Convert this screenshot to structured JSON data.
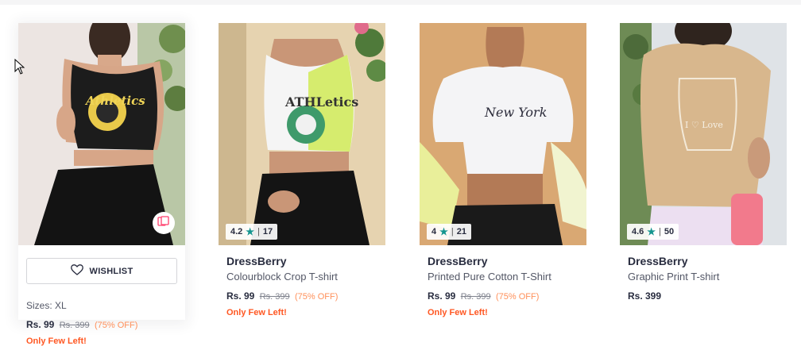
{
  "wishlist_label": "WISHLIST",
  "products": [
    {
      "brand": "",
      "name": "",
      "sizes": "Sizes: XL",
      "price": "Rs. 99",
      "mrp": "Rs. 399",
      "discount": "(75% OFF)",
      "stock_note": "Only Few Left!",
      "rating": "",
      "rating_count": "",
      "image_text": "Athletics",
      "hovered": true
    },
    {
      "brand": "DressBerry",
      "name": "Colourblock Crop T-shirt",
      "price": "Rs. 99",
      "mrp": "Rs. 399",
      "discount": "(75% OFF)",
      "stock_note": "Only Few Left!",
      "rating": "4.2",
      "rating_count": "17",
      "image_text": "ATHLetics"
    },
    {
      "brand": "DressBerry",
      "name": "Printed Pure Cotton T-Shirt",
      "price": "Rs. 99",
      "mrp": "Rs. 399",
      "discount": "(75% OFF)",
      "stock_note": "Only Few Left!",
      "rating": "4",
      "rating_count": "21",
      "image_text": "New York"
    },
    {
      "brand": "DressBerry",
      "name": "Graphic Print T-shirt",
      "price": "Rs. 399",
      "rating": "4.6",
      "rating_count": "50",
      "image_text": "I ♡ Love"
    }
  ],
  "colors": {
    "rating_star": "#14958f",
    "discount": "#ff905a",
    "stock_note": "#ff5722"
  }
}
